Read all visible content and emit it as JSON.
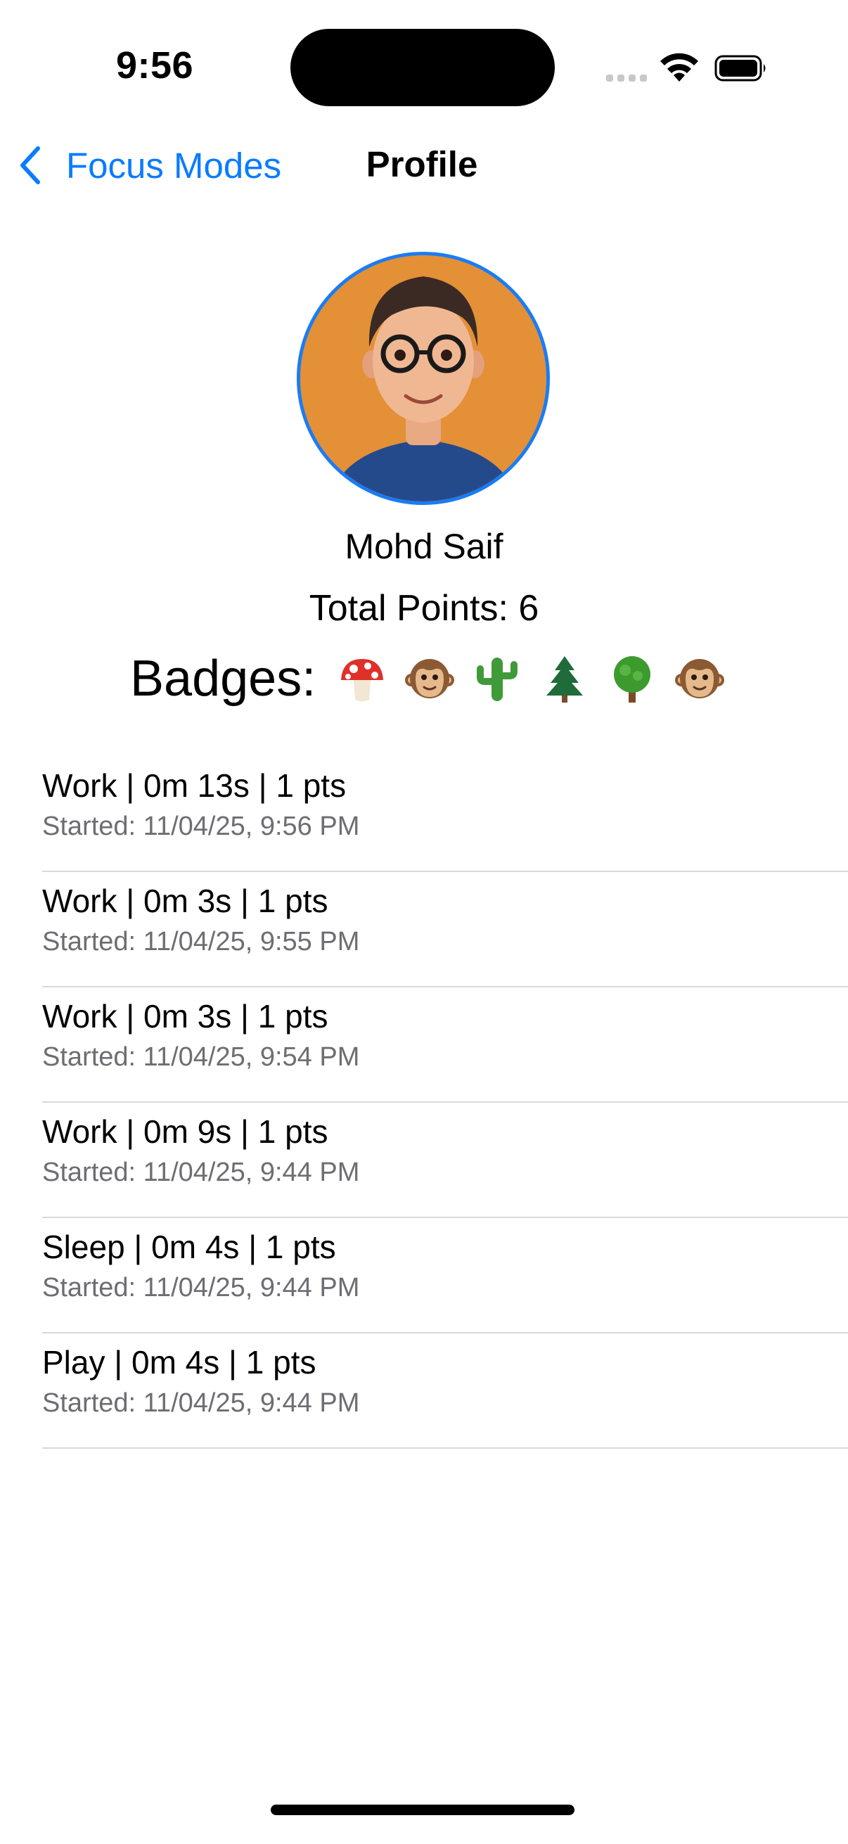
{
  "status_bar": {
    "time": "9:56"
  },
  "nav": {
    "back_label": "Focus Modes",
    "title": "Profile"
  },
  "profile": {
    "name": "Mohd Saif",
    "total_points": "Total Points: 6",
    "badges_label": "Badges:",
    "badges": [
      "mushroom",
      "monkey",
      "cactus",
      "pine-tree",
      "tree",
      "monkey"
    ]
  },
  "sessions": [
    {
      "title": "Work | 0m 13s | 1 pts",
      "started": "Started: 11/04/25, 9:56 PM"
    },
    {
      "title": "Work | 0m 3s | 1 pts",
      "started": "Started: 11/04/25, 9:55 PM"
    },
    {
      "title": "Work | 0m 3s | 1 pts",
      "started": "Started: 11/04/25, 9:54 PM"
    },
    {
      "title": "Work | 0m 9s | 1 pts",
      "started": "Started: 11/04/25, 9:44 PM"
    },
    {
      "title": "Sleep | 0m 4s | 1 pts",
      "started": "Started: 11/04/25, 9:44 PM"
    },
    {
      "title": "Play | 0m 4s | 1 pts",
      "started": "Started: 11/04/25, 9:44 PM"
    }
  ],
  "colors": {
    "accent": "#0a7cff",
    "avatar_border": "#1a7cf5",
    "separator": "#d8d8dc",
    "secondary_text": "#6d6d72"
  }
}
